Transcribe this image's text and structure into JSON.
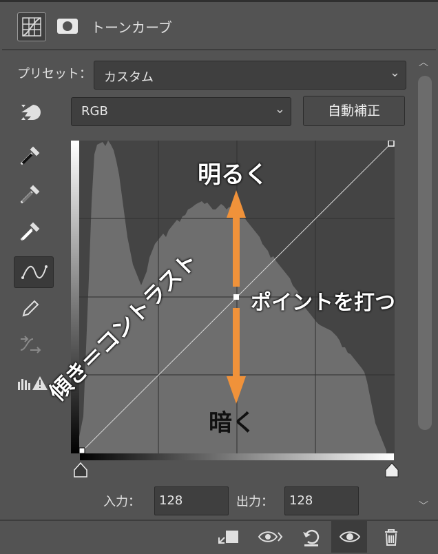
{
  "panel": {
    "title": "トーンカーブ",
    "preset_label": "プリセット：",
    "preset_value": "カスタム",
    "channel_value": "RGB",
    "auto_button": "自動補正",
    "input_label": "入力：",
    "input_value": "128",
    "output_label": "出力：",
    "output_value": "128"
  },
  "tools": [
    "dropper-black-icon",
    "dropper-gray-icon",
    "dropper-white-icon",
    "curve-point-icon",
    "pencil-icon",
    "smooth-icon",
    "clipping-warning-icon"
  ],
  "annotations": {
    "brighter": "明るく",
    "darker": "暗く",
    "point": "ポイントを打つ",
    "slope": "傾き＝コントラスト"
  },
  "colors": {
    "accent_arrow": "#f0923a",
    "panel_bg": "#535353",
    "field_bg": "#3f3f3f"
  },
  "footer": [
    "clip-to-layer-icon",
    "view-previous-icon",
    "reset-icon",
    "visibility-eye-icon",
    "trash-icon"
  ]
}
